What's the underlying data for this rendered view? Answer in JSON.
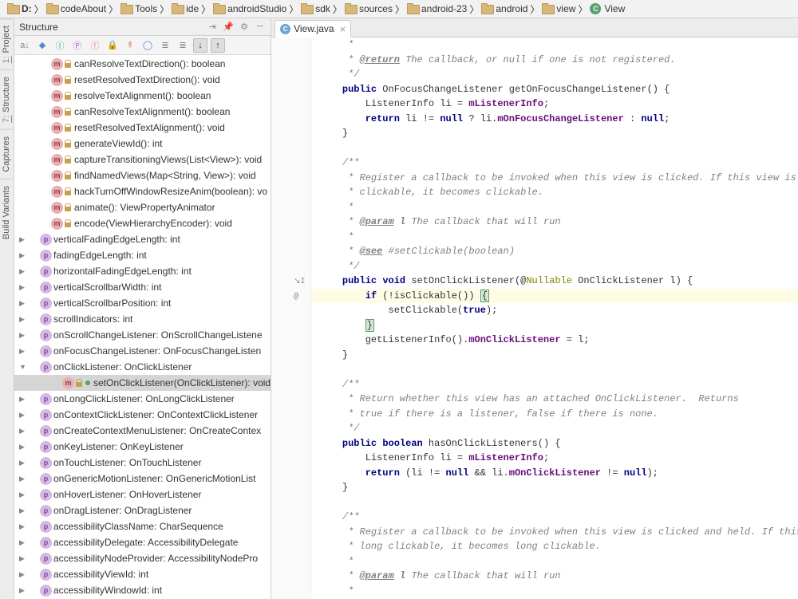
{
  "breadcrumbs": [
    {
      "kind": "drive",
      "label": "D:"
    },
    {
      "kind": "folder",
      "label": "codeAbout"
    },
    {
      "kind": "folder",
      "label": "Tools"
    },
    {
      "kind": "folder",
      "label": "ide"
    },
    {
      "kind": "folder",
      "label": "androidStudio"
    },
    {
      "kind": "folder",
      "label": "sdk"
    },
    {
      "kind": "folder",
      "label": "sources"
    },
    {
      "kind": "folder",
      "label": "android-23"
    },
    {
      "kind": "folder",
      "label": "android"
    },
    {
      "kind": "folder",
      "label": "view"
    },
    {
      "kind": "class",
      "label": "View"
    }
  ],
  "side_tabs": [
    {
      "num": "1",
      "label": "Project"
    },
    {
      "num": "7",
      "label": "Structure"
    },
    {
      "num": "",
      "label": "Captures"
    },
    {
      "num": "",
      "label": "Build Variants"
    }
  ],
  "structure": {
    "title": "Structure",
    "items": [
      {
        "ico": "m",
        "indent": 2,
        "label": "canResolveTextDirection(): boolean",
        "arrow": ""
      },
      {
        "ico": "m",
        "indent": 2,
        "label": "resetResolvedTextDirection(): void",
        "arrow": ""
      },
      {
        "ico": "m",
        "indent": 2,
        "label": "resolveTextAlignment(): boolean",
        "arrow": ""
      },
      {
        "ico": "m",
        "indent": 2,
        "label": "canResolveTextAlignment(): boolean",
        "arrow": ""
      },
      {
        "ico": "m",
        "indent": 2,
        "label": "resetResolvedTextAlignment(): void",
        "arrow": ""
      },
      {
        "ico": "m",
        "indent": 2,
        "label": "generateViewId(): int",
        "arrow": ""
      },
      {
        "ico": "m",
        "indent": 2,
        "label": "captureTransitioningViews(List<View>): void",
        "arrow": ""
      },
      {
        "ico": "m",
        "indent": 2,
        "label": "findNamedViews(Map<String, View>): void",
        "arrow": ""
      },
      {
        "ico": "m",
        "indent": 2,
        "label": "hackTurnOffWindowResizeAnim(boolean): vo",
        "arrow": ""
      },
      {
        "ico": "m",
        "indent": 2,
        "label": "animate(): ViewPropertyAnimator",
        "arrow": ""
      },
      {
        "ico": "m",
        "indent": 2,
        "label": "encode(ViewHierarchyEncoder): void",
        "arrow": ""
      },
      {
        "ico": "p",
        "indent": 1,
        "label": "verticalFadingEdgeLength: int",
        "arrow": "▶"
      },
      {
        "ico": "p",
        "indent": 1,
        "label": "fadingEdgeLength: int",
        "arrow": "▶"
      },
      {
        "ico": "p",
        "indent": 1,
        "label": "horizontalFadingEdgeLength: int",
        "arrow": "▶"
      },
      {
        "ico": "p",
        "indent": 1,
        "label": "verticalScrollbarWidth: int",
        "arrow": "▶"
      },
      {
        "ico": "p",
        "indent": 1,
        "label": "verticalScrollbarPosition: int",
        "arrow": "▶"
      },
      {
        "ico": "p",
        "indent": 1,
        "label": "scrollIndicators: int",
        "arrow": "▶"
      },
      {
        "ico": "p",
        "indent": 1,
        "label": "onScrollChangeListener: OnScrollChangeListene",
        "arrow": "▶"
      },
      {
        "ico": "p",
        "indent": 1,
        "label": "onFocusChangeListener: OnFocusChangeListen",
        "arrow": "▶"
      },
      {
        "ico": "p",
        "indent": 1,
        "label": "onClickListener: OnClickListener",
        "arrow": "▼"
      },
      {
        "ico": "m",
        "indent": 3,
        "label": "setOnClickListener(OnClickListener): void",
        "arrow": "",
        "selected": true,
        "dot": true
      },
      {
        "ico": "p",
        "indent": 1,
        "label": "onLongClickListener: OnLongClickListener",
        "arrow": "▶"
      },
      {
        "ico": "p",
        "indent": 1,
        "label": "onContextClickListener: OnContextClickListener",
        "arrow": "▶"
      },
      {
        "ico": "p",
        "indent": 1,
        "label": "onCreateContextMenuListener: OnCreateContex",
        "arrow": "▶"
      },
      {
        "ico": "p",
        "indent": 1,
        "label": "onKeyListener: OnKeyListener",
        "arrow": "▶"
      },
      {
        "ico": "p",
        "indent": 1,
        "label": "onTouchListener: OnTouchListener",
        "arrow": "▶"
      },
      {
        "ico": "p",
        "indent": 1,
        "label": "onGenericMotionListener: OnGenericMotionList",
        "arrow": "▶"
      },
      {
        "ico": "p",
        "indent": 1,
        "label": "onHoverListener: OnHoverListener",
        "arrow": "▶"
      },
      {
        "ico": "p",
        "indent": 1,
        "label": "onDragListener: OnDragListener",
        "arrow": "▶"
      },
      {
        "ico": "p",
        "indent": 1,
        "label": "accessibilityClassName: CharSequence",
        "arrow": "▶"
      },
      {
        "ico": "p",
        "indent": 1,
        "label": "accessibilityDelegate: AccessibilityDelegate",
        "arrow": "▶"
      },
      {
        "ico": "p",
        "indent": 1,
        "label": "accessibilityNodeProvider: AccessibilityNodePro",
        "arrow": "▶"
      },
      {
        "ico": "p",
        "indent": 1,
        "label": "accessibilityViewId: int",
        "arrow": "▶"
      },
      {
        "ico": "p",
        "indent": 1,
        "label": "accessibilityWindowId: int",
        "arrow": "▶"
      }
    ]
  },
  "editor": {
    "tab": {
      "filename": "View.java"
    },
    "code_lines": [
      {
        "t": "comment",
        "text": "     *"
      },
      {
        "t": "comment",
        "html": "     * <span class='doctag'>@return</span> The callback, or null if one is not registered."
      },
      {
        "t": "comment",
        "text": "     */"
      },
      {
        "t": "code",
        "html": "    <span class='kw'>public</span> OnFocusChangeListener getOnFocusChangeListener() {"
      },
      {
        "t": "code",
        "html": "        ListenerInfo li = <span class='field'>mListenerInfo</span>;"
      },
      {
        "t": "code",
        "html": "        <span class='kw'>return</span> li != <span class='kw'>null</span> ? li.<span class='field'>mOnFocusChangeListener</span> : <span class='kw'>null</span>;"
      },
      {
        "t": "code",
        "html": "    }"
      },
      {
        "t": "blank",
        "text": ""
      },
      {
        "t": "comment",
        "text": "    /**"
      },
      {
        "t": "comment",
        "text": "     * Register a callback to be invoked when this view is clicked. If this view is not"
      },
      {
        "t": "comment",
        "text": "     * clickable, it becomes clickable."
      },
      {
        "t": "comment",
        "text": "     *"
      },
      {
        "t": "comment",
        "html": "     * <span class='doctag'>@param</span> <b>l</b> The callback that will run"
      },
      {
        "t": "comment",
        "text": "     *"
      },
      {
        "t": "comment",
        "html": "     * <span class='doctag'>@see</span> #setClickable(boolean)"
      },
      {
        "t": "comment",
        "text": "     */"
      },
      {
        "t": "code",
        "gutter": "↘I @",
        "html": "    <span class='kw'>public</span> <span class='kw'>void</span> setOnClickListener(@<span class='ann'>Nullable</span> OnClickListener l) {"
      },
      {
        "t": "code",
        "hl": true,
        "html": "        <span class='kw'>if</span> (!isClickable()) <span class='caret-brace'>{</span>"
      },
      {
        "t": "code",
        "html": "            setClickable(<span class='kw'>true</span>);"
      },
      {
        "t": "code",
        "html": "        <span class='caret-brace'>}</span>"
      },
      {
        "t": "code",
        "html": "        getListenerInfo().<span class='field'>mOnClickListener</span> = l;"
      },
      {
        "t": "code",
        "html": "    }"
      },
      {
        "t": "blank",
        "text": ""
      },
      {
        "t": "comment",
        "text": "    /**"
      },
      {
        "t": "comment",
        "text": "     * Return whether this view has an attached OnClickListener.  Returns"
      },
      {
        "t": "comment",
        "text": "     * true if there is a listener, false if there is none."
      },
      {
        "t": "comment",
        "text": "     */"
      },
      {
        "t": "code",
        "html": "    <span class='kw'>public</span> <span class='kw'>boolean</span> hasOnClickListeners() {"
      },
      {
        "t": "code",
        "html": "        ListenerInfo li = <span class='field'>mListenerInfo</span>;"
      },
      {
        "t": "code",
        "html": "        <span class='kw'>return</span> (li != <span class='kw'>null</span> && li.<span class='field'>mOnClickListener</span> != <span class='kw'>null</span>);"
      },
      {
        "t": "code",
        "html": "    }"
      },
      {
        "t": "blank",
        "text": ""
      },
      {
        "t": "comment",
        "text": "    /**"
      },
      {
        "t": "comment",
        "text": "     * Register a callback to be invoked when this view is clicked and held. If this view is not"
      },
      {
        "t": "comment",
        "text": "     * long clickable, it becomes long clickable."
      },
      {
        "t": "comment",
        "text": "     *"
      },
      {
        "t": "comment",
        "html": "     * <span class='doctag'>@param</span> <b>l</b> The callback that will run"
      },
      {
        "t": "comment",
        "text": "     *"
      }
    ]
  }
}
